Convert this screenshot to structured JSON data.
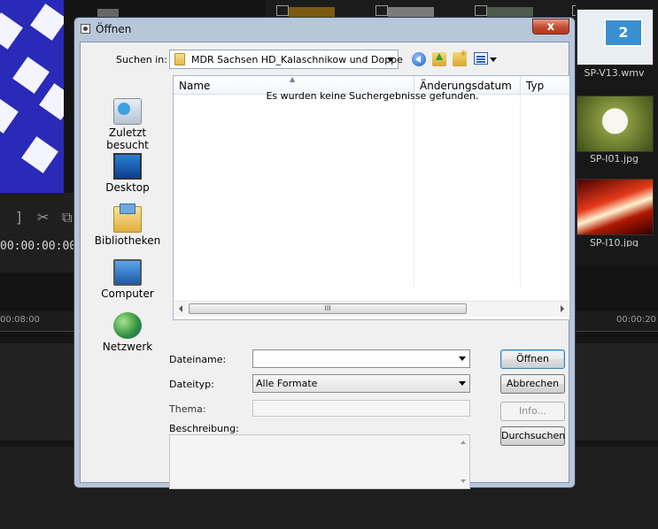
{
  "background_app": {
    "timecode": "00:00:00:00",
    "ruler_marks": [
      "00:08:00",
      "00:00:20"
    ],
    "library_items": [
      {
        "label": "SP-V13.wmv",
        "badge": "2"
      },
      {
        "label": "SP-I01.jpg"
      },
      {
        "label": "SP-I10.jpg"
      }
    ]
  },
  "dialog": {
    "title": "Öffnen",
    "close_label": "x",
    "lookin": {
      "label": "Suchen in:",
      "value": "MDR Sachsen HD_Kalaschnikow und Doppe"
    },
    "places": [
      {
        "label": "Zuletzt besucht",
        "icon": "recent-places-icon"
      },
      {
        "label": "Desktop",
        "icon": "desktop-icon"
      },
      {
        "label": "Bibliotheken",
        "icon": "libraries-icon"
      },
      {
        "label": "Computer",
        "icon": "computer-icon"
      },
      {
        "label": "Netzwerk",
        "icon": "network-icon"
      }
    ],
    "columns": [
      "Name",
      "Änderungsdatum",
      "Typ"
    ],
    "empty_message": "Es wurden keine Suchergebnisse gefunden.",
    "scroll_grip": "III",
    "filename": {
      "label": "Dateiname:",
      "value": ""
    },
    "filetype": {
      "label": "Dateityp:",
      "value": "Alle Formate"
    },
    "thema": {
      "label": "Thema:",
      "value": ""
    },
    "beschreibung": {
      "label": "Beschreibung:",
      "value": ""
    },
    "buttons": {
      "open": "Öffnen",
      "cancel": "Abbrechen",
      "info": "Info...",
      "browse": "Durchsuchen"
    }
  },
  "colors": {
    "dialog_frame": "#b7c6d9",
    "close_button": "#c44a2f",
    "default_button_border": "#3c7fb1"
  }
}
